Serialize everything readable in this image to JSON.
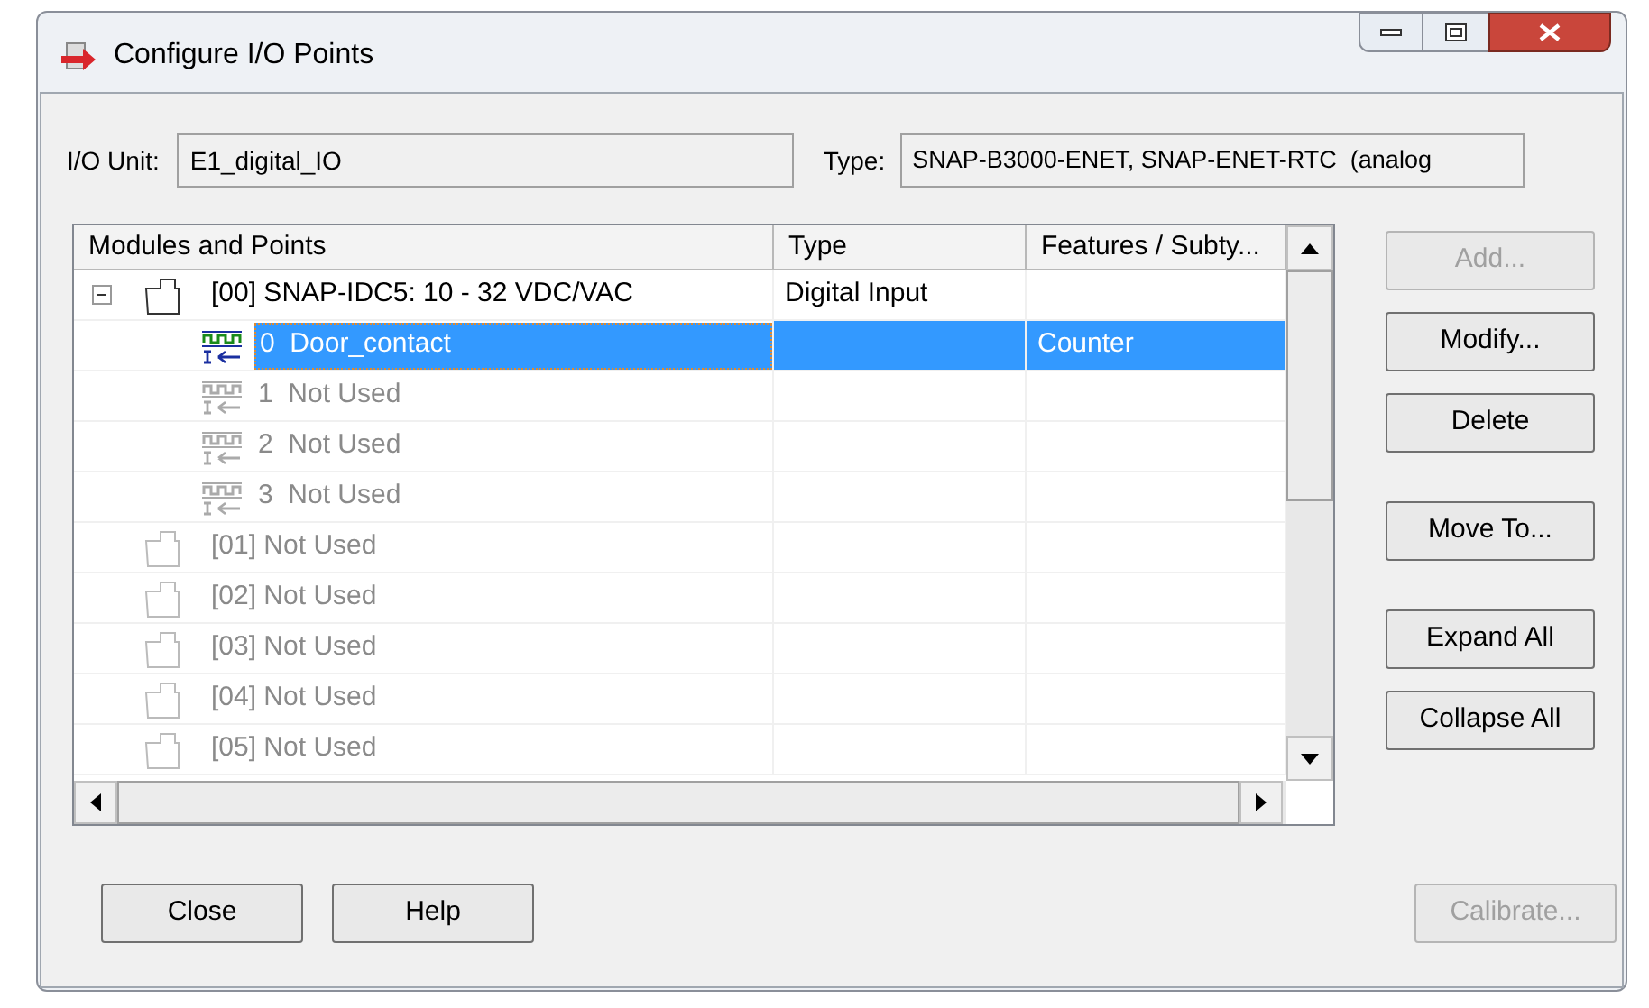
{
  "window": {
    "title": "Configure I/O Points"
  },
  "io_unit": {
    "label": "I/O Unit:",
    "value": "E1_digital_IO"
  },
  "type": {
    "label": "Type:",
    "value": "SNAP-B3000-ENET, SNAP-ENET-RTC  (analog"
  },
  "table": {
    "columns": [
      "Modules and Points",
      "Type",
      "Features / Subty..."
    ],
    "rows": [
      {
        "kind": "module",
        "label": "[00] SNAP-IDC5: 10 - 32 VDC/VAC",
        "type": "Digital Input",
        "expanded": true,
        "used": true,
        "selected": false,
        "children": [
          {
            "kind": "point",
            "label": "0  Door_contact",
            "features": "Counter",
            "used": true,
            "selected": true
          },
          {
            "kind": "point",
            "label": "1  Not Used",
            "used": false,
            "selected": false
          },
          {
            "kind": "point",
            "label": "2  Not Used",
            "used": false,
            "selected": false
          },
          {
            "kind": "point",
            "label": "3  Not Used",
            "used": false,
            "selected": false
          }
        ]
      },
      {
        "kind": "module",
        "label": "[01] Not Used",
        "used": false,
        "selected": false
      },
      {
        "kind": "module",
        "label": "[02] Not Used",
        "used": false,
        "selected": false
      },
      {
        "kind": "module",
        "label": "[03] Not Used",
        "used": false,
        "selected": false
      },
      {
        "kind": "module",
        "label": "[04] Not Used",
        "used": false,
        "selected": false
      },
      {
        "kind": "module",
        "label": "[05] Not Used",
        "used": false,
        "selected": false
      }
    ]
  },
  "side_buttons": [
    {
      "label": "Add...",
      "disabled": true
    },
    {
      "label": "Modify...",
      "disabled": false
    },
    {
      "label": "Delete",
      "disabled": false
    },
    {
      "label": "Move To...",
      "disabled": false
    },
    {
      "label": "Expand All",
      "disabled": false
    },
    {
      "label": "Collapse All",
      "disabled": false
    }
  ],
  "bottom_buttons": [
    {
      "label": "Close",
      "disabled": false
    },
    {
      "label": "Help",
      "disabled": false
    },
    {
      "label": "Calibrate...",
      "disabled": true
    }
  ]
}
